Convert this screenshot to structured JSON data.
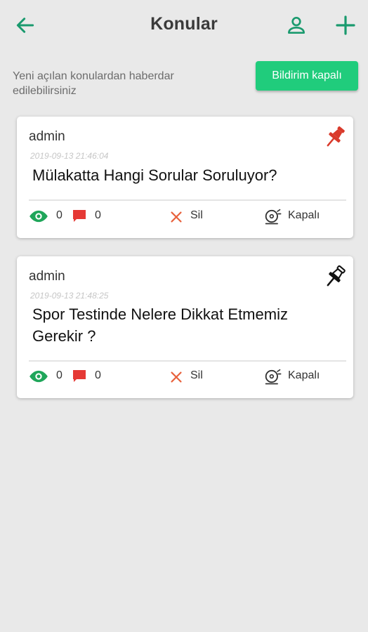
{
  "header": {
    "title": "Konular"
  },
  "notify": {
    "text": "Yeni açılan konulardan haberdar edilebilirsiniz",
    "button_label": "Bildirim kapalı"
  },
  "colors": {
    "accent": "#1a9a6e",
    "button": "#20cc7c",
    "pinned": "#d93a2b",
    "views": "#1fa65a",
    "comments": "#e53935",
    "delete": "#e8623d"
  },
  "topics": [
    {
      "author": "admin",
      "date": "2019-09-13 21:46:04",
      "title": "Mülakatta Hangi Sorular Soruluyor?",
      "pinned": true,
      "views": "0",
      "comments": "0",
      "delete_label": "Sil",
      "notify_label": "Kapalı"
    },
    {
      "author": "admin",
      "date": "2019-09-13 21:48:25",
      "title": "Spor Testinde Nelere Dikkat Etmemiz Gerekir ?",
      "pinned": false,
      "views": "0",
      "comments": "0",
      "delete_label": "Sil",
      "notify_label": "Kapalı"
    }
  ]
}
